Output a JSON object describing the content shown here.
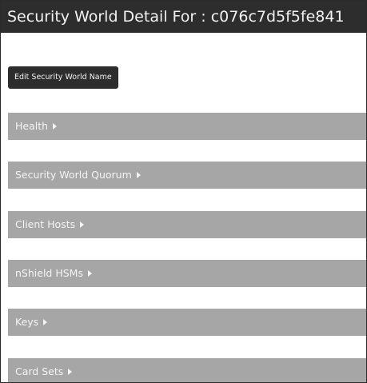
{
  "page": {
    "title": "Security World Detail For : c076c7d5f5fe841"
  },
  "actions": {
    "edit_label": "Edit Security World Name"
  },
  "sections": [
    {
      "label": "Health"
    },
    {
      "label": "Security World Quorum"
    },
    {
      "label": "Client Hosts"
    },
    {
      "label": "nShield HSMs"
    },
    {
      "label": "Keys"
    },
    {
      "label": "Card Sets"
    }
  ]
}
